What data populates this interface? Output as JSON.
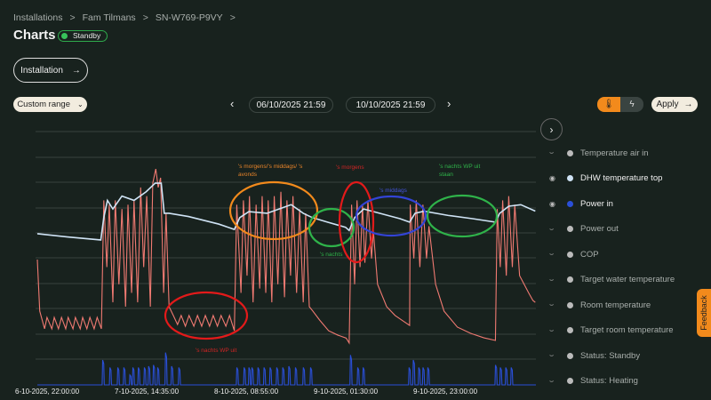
{
  "breadcrumb": [
    "Installations",
    "Fam Tilmans",
    "SN-W769-P9VY"
  ],
  "breadcrumb_sep": ">",
  "page_title": "Charts",
  "status_badge": "Standby",
  "installation_button": "Installation",
  "range_select": "Custom range",
  "date_from": "06/10/2025 21:59",
  "date_to": "10/10/2025 21:59",
  "apply_label": "Apply",
  "feedback_label": "Feedback",
  "legend": [
    {
      "label": "Temperature air in",
      "visible": false,
      "color": "#bbbbbb"
    },
    {
      "label": "DHW temperature top",
      "visible": true,
      "color": "#cfe3f5"
    },
    {
      "label": "Power in",
      "visible": true,
      "color": "#2a4fd8"
    },
    {
      "label": "Power out",
      "visible": false,
      "color": "#bbbbbb"
    },
    {
      "label": "COP",
      "visible": false,
      "color": "#bbbbbb"
    },
    {
      "label": "Target water temperature",
      "visible": false,
      "color": "#bbbbbb"
    },
    {
      "label": "Room temperature",
      "visible": false,
      "color": "#bbbbbb"
    },
    {
      "label": "Target room temperature",
      "visible": false,
      "color": "#bbbbbb"
    },
    {
      "label": "Status: Standby",
      "visible": false,
      "color": "#bbbbbb"
    },
    {
      "label": "Status: Heating",
      "visible": false,
      "color": "#bbbbbb"
    }
  ],
  "annotations": {
    "a1_line1": "'s morgens/'s middags/ 's",
    "a1_line2": "avonds",
    "a2": "'s morgens",
    "a3": "'s middags",
    "a4_line1": "'s nachts WP uit",
    "a4_line2": "staan",
    "a5": "'s nachts",
    "a6": "'s nachts WP uit"
  },
  "chart_data": {
    "type": "line",
    "x_unit": "hours since 6-10-2025 22:00",
    "xlim": [
      0,
      82.5
    ],
    "ylim": [
      0,
      100
    ],
    "x_tick_labels": [
      "6-10-2025, 22:00:00",
      "7-10-2025, 14:35:00",
      "8-10-2025, 08:55:00",
      "9-10-2025, 01:30:00",
      "9-10-2025, 23:00:00"
    ],
    "series": [
      {
        "name": "",
        "color": "#f07a72",
        "points": [
          [
            0,
            40.5
          ],
          [
            0.4,
            16.5
          ],
          [
            1.2,
            8.3
          ],
          [
            1.6,
            13.6
          ],
          [
            2.4,
            8.3
          ],
          [
            2.8,
            13.6
          ],
          [
            3.5,
            8.3
          ],
          [
            4,
            13.6
          ],
          [
            4.7,
            8.3
          ],
          [
            5.1,
            13.6
          ],
          [
            5.9,
            8.3
          ],
          [
            6.3,
            13.6
          ],
          [
            7.1,
            8.3
          ],
          [
            7.5,
            13.6
          ],
          [
            8.2,
            8.3
          ],
          [
            8.7,
            13.6
          ],
          [
            9.4,
            8.3
          ],
          [
            9.9,
            13.6
          ],
          [
            10.6,
            8.3
          ],
          [
            11,
            68
          ],
          [
            11.5,
            37
          ],
          [
            11.9,
            66
          ],
          [
            12.5,
            20.6
          ],
          [
            12.9,
            68
          ],
          [
            13.5,
            29
          ],
          [
            14,
            64
          ],
          [
            14.6,
            18.6
          ],
          [
            15,
            66
          ],
          [
            15.6,
            25
          ],
          [
            16,
            68
          ],
          [
            16.6,
            20.6
          ],
          [
            17.1,
            74
          ],
          [
            17.6,
            37
          ],
          [
            18.1,
            70
          ],
          [
            18.7,
            18.6
          ],
          [
            19.1,
            76
          ],
          [
            19.6,
            82.6
          ],
          [
            20,
            74
          ],
          [
            20.4,
            78.5
          ],
          [
            20.9,
            25
          ],
          [
            21.3,
            62
          ],
          [
            21.8,
            18.6
          ],
          [
            22.5,
            14.5
          ],
          [
            23.2,
            10.3
          ],
          [
            23.8,
            14.5
          ],
          [
            24.5,
            9.5
          ],
          [
            25.1,
            14.5
          ],
          [
            25.9,
            9.5
          ],
          [
            26.5,
            14.5
          ],
          [
            27.2,
            9.5
          ],
          [
            27.8,
            14.5
          ],
          [
            28.5,
            9.5
          ],
          [
            29.1,
            14.5
          ],
          [
            29.8,
            9.5
          ],
          [
            30.4,
            14.5
          ],
          [
            31.2,
            9.5
          ],
          [
            31.8,
            14.5
          ],
          [
            32.6,
            7.4
          ],
          [
            33,
            66
          ],
          [
            33.7,
            25
          ],
          [
            34.1,
            68
          ],
          [
            34.7,
            33
          ],
          [
            35.1,
            70
          ],
          [
            35.7,
            20.6
          ],
          [
            36.2,
            66
          ],
          [
            36.8,
            27
          ],
          [
            37.2,
            70
          ],
          [
            37.8,
            25
          ],
          [
            38.2,
            68
          ],
          [
            38.8,
            20.6
          ],
          [
            39.2,
            70
          ],
          [
            39.8,
            29
          ],
          [
            40.3,
            72
          ],
          [
            40.9,
            23
          ],
          [
            41.3,
            68
          ],
          [
            41.9,
            33
          ],
          [
            42.3,
            70
          ],
          [
            42.9,
            25
          ],
          [
            43.4,
            64
          ],
          [
            44,
            20.6
          ],
          [
            44.4,
            62
          ],
          [
            45,
            18.6
          ],
          [
            45.6,
            16.5
          ],
          [
            46.7,
            12.4
          ],
          [
            48.2,
            7.4
          ],
          [
            49.7,
            5.4
          ],
          [
            51.1,
            4
          ],
          [
            51.6,
            1.7
          ],
          [
            52,
            66
          ],
          [
            52.5,
            29
          ],
          [
            52.9,
            68
          ],
          [
            53.4,
            37
          ],
          [
            53.8,
            66
          ],
          [
            54.2,
            39
          ],
          [
            54.7,
            68
          ],
          [
            55.3,
            41
          ],
          [
            55.6,
            54
          ],
          [
            56.3,
            29
          ],
          [
            57.8,
            18.6
          ],
          [
            59.2,
            14.5
          ],
          [
            60.7,
            11.6
          ],
          [
            61.6,
            9.9
          ],
          [
            61.7,
            66
          ],
          [
            62.3,
            41
          ],
          [
            62.7,
            68
          ],
          [
            63.3,
            37
          ],
          [
            63.8,
            66
          ],
          [
            64.4,
            41
          ],
          [
            64.8,
            56
          ],
          [
            65.9,
            29
          ],
          [
            67.3,
            16.5
          ],
          [
            69.5,
            9.1
          ],
          [
            71.7,
            6.2
          ],
          [
            73.9,
            4.1
          ],
          [
            75.8,
            2.9
          ],
          [
            76.1,
            64
          ],
          [
            76.6,
            37
          ],
          [
            77,
            68
          ],
          [
            77.6,
            33
          ],
          [
            78,
            70
          ],
          [
            78.6,
            37
          ],
          [
            79,
            66
          ],
          [
            79.8,
            33
          ],
          [
            81.3,
            25
          ],
          [
            82,
            21.5
          ],
          [
            82.4,
            20.6
          ]
        ]
      },
      {
        "name": "DHW temperature top",
        "color": "#cfe3f5",
        "points": [
          [
            0,
            52.5
          ],
          [
            5,
            51
          ],
          [
            10.5,
            49.6
          ],
          [
            11,
            60
          ],
          [
            11.6,
            68
          ],
          [
            12.5,
            64
          ],
          [
            14,
            70
          ],
          [
            16,
            68
          ],
          [
            18,
            72
          ],
          [
            19.5,
            76
          ],
          [
            20.5,
            76
          ],
          [
            21,
            62
          ],
          [
            21.8,
            62
          ],
          [
            25,
            60.5
          ],
          [
            30,
            57
          ],
          [
            32.6,
            54.5
          ],
          [
            33.5,
            60
          ],
          [
            35,
            62.8
          ],
          [
            38,
            62
          ],
          [
            40,
            64
          ],
          [
            42,
            66
          ],
          [
            44,
            62
          ],
          [
            45.5,
            60
          ],
          [
            48,
            57.9
          ],
          [
            51,
            55.5
          ],
          [
            51.6,
            54
          ],
          [
            52.5,
            60
          ],
          [
            54,
            64
          ],
          [
            56,
            62.5
          ],
          [
            60,
            59.5
          ],
          [
            61.6,
            57.9
          ],
          [
            62.5,
            62
          ],
          [
            64,
            63
          ],
          [
            68,
            61
          ],
          [
            72,
            59.5
          ],
          [
            75.8,
            57.9
          ],
          [
            76.5,
            62
          ],
          [
            78,
            65.3
          ],
          [
            80,
            66
          ],
          [
            82.4,
            63
          ]
        ]
      },
      {
        "name": "Power in",
        "color": "#2a4fd8",
        "panel": "lower",
        "pulses": [
          [
            10.9,
            100
          ],
          [
            12.1,
            70
          ],
          [
            13.4,
            70
          ],
          [
            14.4,
            70
          ],
          [
            15.4,
            40
          ],
          [
            15.9,
            70
          ],
          [
            16.8,
            70
          ],
          [
            17.8,
            70
          ],
          [
            18.5,
            75
          ],
          [
            19.3,
            80
          ],
          [
            20,
            70
          ],
          [
            21.3,
            130
          ],
          [
            22.3,
            75
          ],
          [
            23.5,
            70
          ],
          [
            33.1,
            70
          ],
          [
            34.3,
            70
          ],
          [
            35.1,
            70
          ],
          [
            35.6,
            70
          ],
          [
            36.6,
            70
          ],
          [
            37.6,
            70
          ],
          [
            38.6,
            70
          ],
          [
            39.7,
            70
          ],
          [
            40.7,
            70
          ],
          [
            41.7,
            75
          ],
          [
            42.8,
            70
          ],
          [
            44.1,
            70
          ],
          [
            45.3,
            70
          ],
          [
            51.9,
            120
          ],
          [
            53.1,
            70
          ],
          [
            54,
            70
          ],
          [
            61.6,
            70
          ],
          [
            62.3,
            100
          ],
          [
            63.2,
            70
          ],
          [
            63.9,
            70
          ],
          [
            64.7,
            70
          ],
          [
            75.9,
            80
          ],
          [
            76.7,
            70
          ],
          [
            77.6,
            70
          ],
          [
            78.5,
            70
          ]
        ]
      }
    ]
  }
}
